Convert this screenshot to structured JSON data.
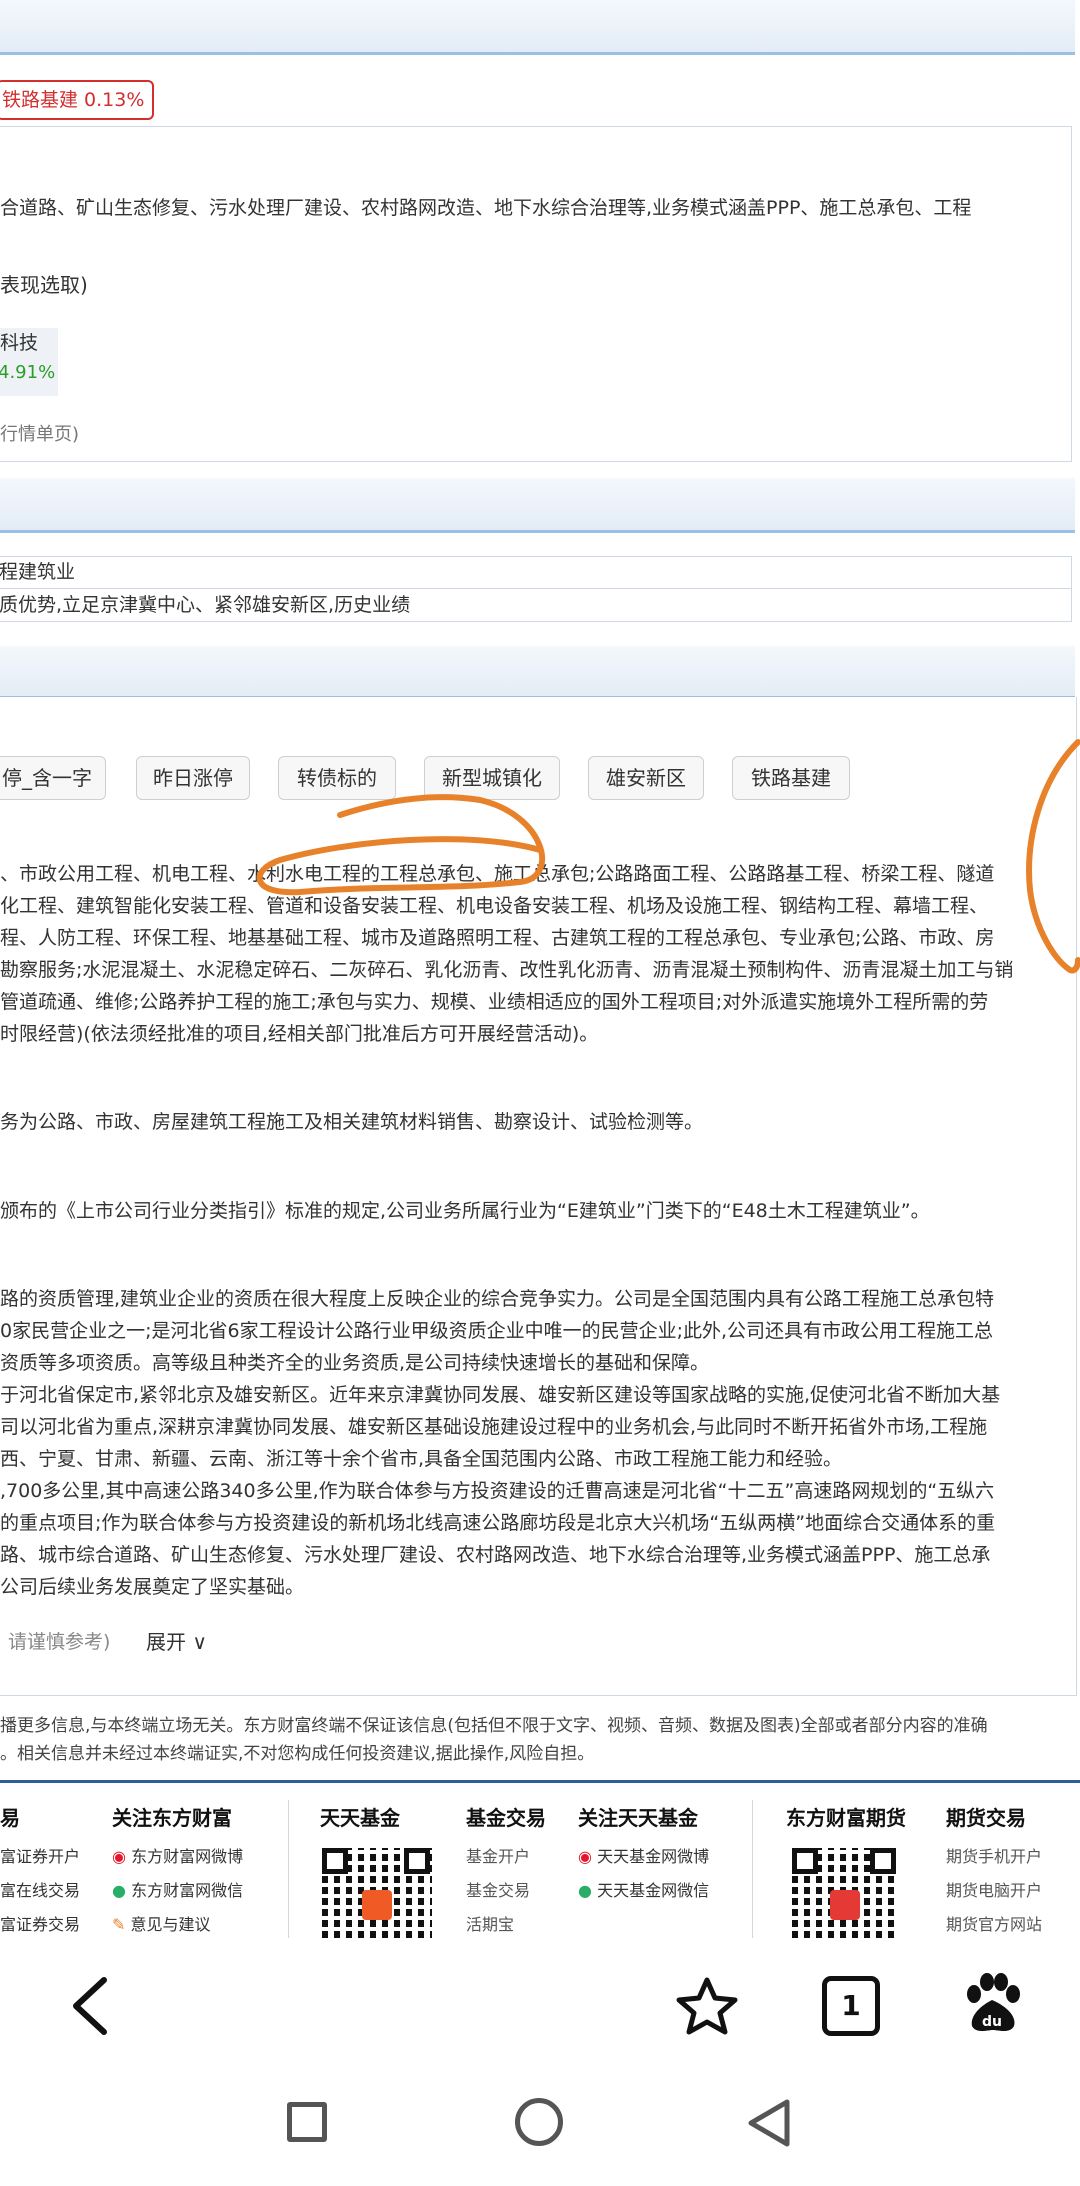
{
  "colors": {
    "header_gradient_top": "#f4f8fc",
    "header_gradient_bottom": "#e3ecf6",
    "header_border": "#9cc0df",
    "badge_red": "#d32f2f",
    "gain_green": "#2a9d2a",
    "annotation_orange": "#e8822a",
    "footer_border": "#2d5e94"
  },
  "concept_badge": {
    "text": "铁路基建 0.13%"
  },
  "business_text": "合道路、矿山生态修复、污水处理厂建设、农村路网改造、地下水综合治理等,业务模式涵盖PPP、施工总承包、工程",
  "selection_note": "表现选取)",
  "related_stock": {
    "name": "科技",
    "change": "4.91%"
  },
  "detail_link": "行情单页)",
  "industry_rows": [
    "程建筑业",
    "质优势,立足京津冀中心、紧邻雄安新区,历史业绩"
  ],
  "tags": [
    "停_含一字",
    "昨日涨停",
    "转债标的",
    "新型城镇化",
    "雄安新区",
    "铁路基建"
  ],
  "scope_lines": [
    "、市政公用工程、机电工程、水利水电工程的工程总承包、施工总承包;公路路面工程、公路路基工程、桥梁工程、隧道",
    "化工程、建筑智能化安装工程、管道和设备安装工程、机电设备安装工程、机场及设施工程、钢结构工程、幕墙工程、",
    "程、人防工程、环保工程、地基基础工程、城市及道路照明工程、古建筑工程的工程总承包、专业承包;公路、市政、房",
    "勘察服务;水泥混凝土、水泥稳定碎石、二灰碎石、乳化沥青、改性乳化沥青、沥青混凝土预制构件、沥青混凝土加工与销",
    "管道疏通、维修;公路养护工程的施工;承包与实力、规模、业绩相适应的国外工程项目;对外派遣实施境外工程所需的劳",
    "时限经营)(依法须经批准的项目,经相关部门批准后方可开展经营活动)。"
  ],
  "main_business": "务为公路、市政、房屋建筑工程施工及相关建筑材料销售、勘察设计、试验检测等。",
  "industry_class": "颁布的《上市公司行业分类指引》标准的规定,公司业务所属行业为“E建筑业”门类下的“E48土木工程建筑业”。",
  "advantage_lines": [
    "路的资质管理,建筑业企业的资质在很大程度上反映企业的综合竞争实力。公司是全国范围内具有公路工程施工总承包特",
    "0家民营企业之一;是河北省6家工程设计公路行业甲级资质企业中唯一的民营企业;此外,公司还具有市政公用工程施工总",
    "资质等多项资质。高等级且种类齐全的业务资质,是公司持续快速增长的基础和保障。",
    "于河北省保定市,紧邻北京及雄安新区。近年来京津冀协同发展、雄安新区建设等国家战略的实施,促使河北省不断加大基",
    "司以河北省为重点,深耕京津冀协同发展、雄安新区基础设施建设过程中的业务机会,与此同时不断开拓省外市场,工程施",
    "西、宁夏、甘肃、新疆、云南、浙江等十余个省市,具备全国范围内公路、市政工程施工能力和经验。",
    ",700多公里,其中高速公路340多公里,作为联合体参与方投资建设的迁曹高速是河北省“十二五”高速路网规划的“五纵六",
    "的重点项目;作为联合体参与方投资建设的新机场北线高速公路廊坊段是北京大兴机场“五纵两横”地面综合交通体系的重",
    "路、城市综合道路、矿山生态修复、污水处理厂建设、农村路网改造、地下水综合治理等,业务模式涵盖PPP、施工总承",
    "公司后续业务发展奠定了坚实基础。"
  ],
  "caution_note": "请谨慎参考)",
  "expand_label": "展开 ∨",
  "disclaimer_lines": [
    "播更多信息,与本终端立场无关。东方财富终端不保证该信息(包括但不限于文字、视频、音频、数据及图表)全部或者部分内容的准确",
    "。相关信息并未经过本终端证实,不对您构成任何投资建议,据此操作,风险自担。"
  ],
  "footer": {
    "col1": {
      "head": "易",
      "links": [
        "富证券开户",
        "富在线交易",
        "富证券交易"
      ]
    },
    "col2": {
      "head": "关注东方财富",
      "links": [
        "东方财富网微博",
        "东方财富网微信",
        "意见与建议"
      ]
    },
    "col3": {
      "head": "天天基金"
    },
    "col4": {
      "head": "基金交易",
      "links": [
        "基金开户",
        "基金交易",
        "活期宝"
      ]
    },
    "col5": {
      "head": "关注天天基金",
      "links": [
        "天天基金网微博",
        "天天基金网微信"
      ]
    },
    "col6": {
      "head": "东方财富期货"
    },
    "col7": {
      "head": "期货交易",
      "links": [
        "期货手机开户",
        "期货电脑开户",
        "期货官方网站"
      ]
    }
  },
  "browser": {
    "tab_count": "1"
  }
}
